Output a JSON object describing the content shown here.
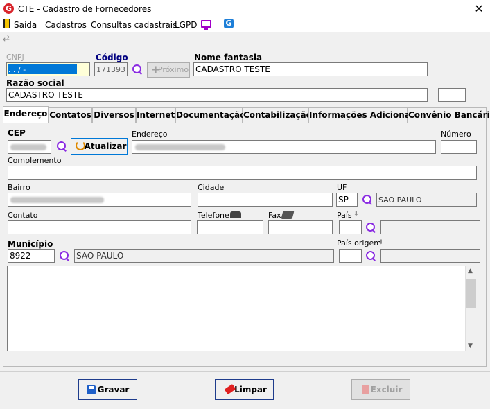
{
  "window": {
    "title": "CTE - Cadastro de Fornecedores",
    "logo_letter": "G"
  },
  "menu": {
    "items": [
      "Saída",
      "Cadastros",
      "Consultas cadastrais",
      "LGPD"
    ]
  },
  "header": {
    "cnpj_label": "CNPJ",
    "cnpj_value": "  .   .   /    -  ",
    "codigo_label": "Código",
    "codigo_value": "171393",
    "proximo_label": "Próximo",
    "nome_fantasia_label": "Nome fantasia",
    "nome_fantasia_value": "CADASTRO TESTE",
    "razao_social_label": "Razão social",
    "razao_social_value": "CADASTRO TESTE",
    "extra_value": ""
  },
  "tabs": [
    "Endereço",
    "Contatos",
    "Diversos",
    "Internet",
    "Documentação",
    "Contabilização",
    "Informações Adicionais",
    "Convênio Bancário"
  ],
  "endereco": {
    "cep_label": "CEP",
    "atualizar_label": "Atualizar",
    "endereco_label": "Endereço",
    "numero_label": "Número",
    "numero_value": "",
    "complemento_label": "Complemento",
    "complemento_value": "",
    "bairro_label": "Bairro",
    "cidade_label": "Cidade",
    "cidade_value": "",
    "uf_label": "UF",
    "uf_value": "SP",
    "uf_name": "SAO PAULO",
    "contato_label": "Contato",
    "telefone_label": "Telefone",
    "fax_label": "Fax",
    "pais_label": "País",
    "municipio_label": "Município",
    "municipio_code": "8922",
    "municipio_name": "SAO PAULO",
    "pais_origem_label": "País origem"
  },
  "buttons": {
    "gravar": "Gravar",
    "limpar": "Limpar",
    "excluir": "Excluir"
  },
  "colors": {
    "accent": "#0078d7",
    "search_icon": "#8a2be2",
    "brand": "#d9242b"
  }
}
